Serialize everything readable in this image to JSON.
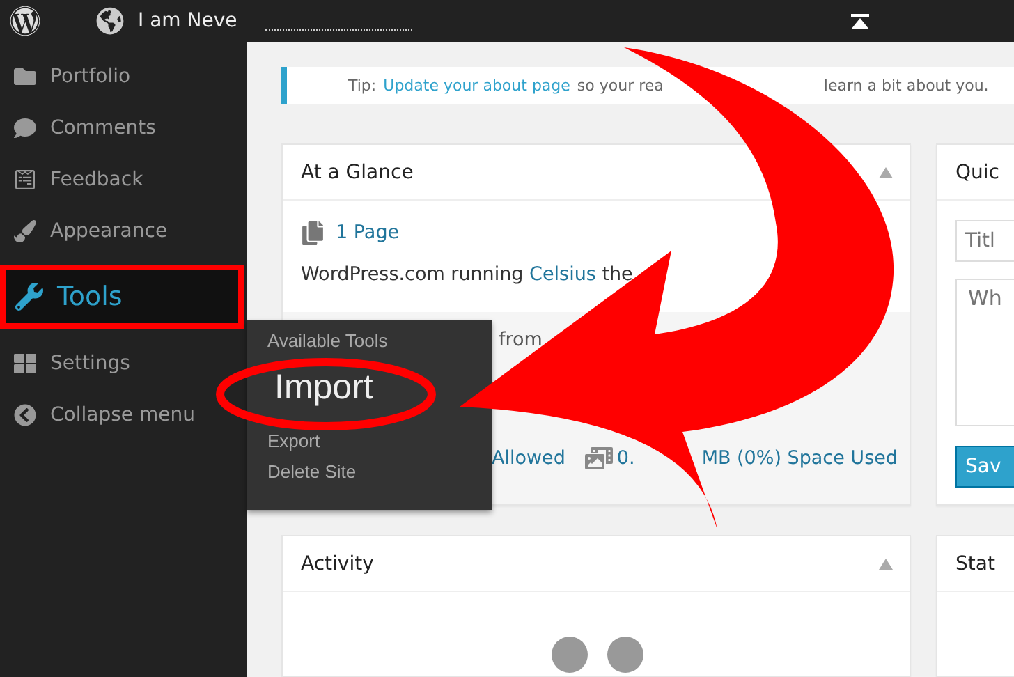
{
  "top_bar": {
    "site_name": "I am Neve"
  },
  "sidebar": {
    "items": [
      {
        "label": "Portfolio",
        "selected": false
      },
      {
        "label": "Comments",
        "selected": false
      },
      {
        "label": "Feedback",
        "selected": false
      },
      {
        "label": "Appearance",
        "selected": false
      },
      {
        "label": "Tools",
        "selected": true
      },
      {
        "label": "Settings",
        "selected": false
      },
      {
        "label": "Collapse menu",
        "selected": false
      }
    ]
  },
  "flyout": {
    "items": [
      {
        "label": "Available Tools",
        "selected": false
      },
      {
        "label": "Import",
        "selected": true
      },
      {
        "label": "Export",
        "selected": false
      },
      {
        "label": "Delete Site",
        "selected": false
      }
    ]
  },
  "tip": {
    "label": "Tip:",
    "link": "Update your about page",
    "text_1": "so your rea",
    "text_2": "learn a bit about you."
  },
  "at_a_glance": {
    "title": "At a Glance",
    "pages": "1 Page",
    "running_prefix": "WordPress.com running",
    "theme": "Celsius",
    "running_suffix": "the",
    "from": "from",
    "allowed": "Allowed",
    "space": "MB (0%) Space Used",
    "space_prefix": "0."
  },
  "quick_draft": {
    "title": "Quic",
    "title_placeholder": "Titl",
    "content_placeholder": "Wh",
    "save": "Sav"
  },
  "activity": {
    "title": "Activity"
  },
  "stats": {
    "title": "Stat"
  }
}
